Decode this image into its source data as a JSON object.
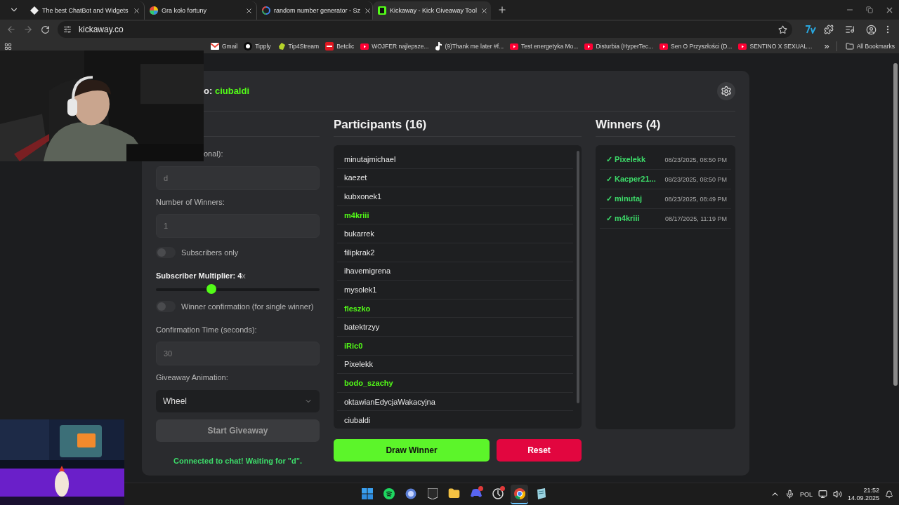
{
  "browser": {
    "tabs": [
      {
        "title": "The best ChatBot and Widgets",
        "kind": "bot",
        "selected": false
      },
      {
        "title": "Gra koło fortuny",
        "kind": "wheel",
        "selected": false
      },
      {
        "title": "random number generator - Sz",
        "kind": "google",
        "selected": false
      },
      {
        "title": "Kickaway - Kick Giveaway Tool",
        "kind": "kick",
        "selected": true
      }
    ],
    "url": "kickaway.co",
    "bookmarks": [
      {
        "label": "Gmail",
        "kind": "mail"
      },
      {
        "label": "Tipply",
        "kind": "tip"
      },
      {
        "label": "Tip4Stream",
        "kind": "hand"
      },
      {
        "label": "Betclic",
        "kind": "bet"
      },
      {
        "label": "WOJFER najlepsze...",
        "kind": "video"
      },
      {
        "label": "(9)Thank me later #f...",
        "kind": "note"
      },
      {
        "label": "Test energetyka Mo...",
        "kind": "video"
      },
      {
        "label": "Disturbia (HyperTec...",
        "kind": "video"
      },
      {
        "label": "Sen O Przyszłości (D...",
        "kind": "video"
      },
      {
        "label": "SENTINO X SEXUAL...",
        "kind": "video"
      }
    ],
    "overflow": "»",
    "all_bookmarks": "All Bookmarks"
  },
  "header": {
    "label": "o:",
    "channel": "ciubaldi"
  },
  "form": {
    "keyword_label": "onal):",
    "keyword_value": "d",
    "winners_label": "Number of Winners:",
    "winners_value": "1",
    "subscribers_only": {
      "label": "Subscribers only",
      "on": false
    },
    "multiplier": {
      "label": "Subscriber Multiplier: 4",
      "unit": "x",
      "level": 0.34
    },
    "confirmation": {
      "label": "Winner confirmation (for single winner)",
      "on": false
    },
    "time_label": "Confirmation Time (seconds):",
    "time_value": "30",
    "animation_label": "Giveaway Animation:",
    "animation_value": "Wheel",
    "start": {
      "label": "Start Giveaway",
      "disabled": true
    },
    "status": "Connected to chat! Waiting for \"d\"."
  },
  "participants": {
    "title": "Participants (16)",
    "items": [
      {
        "name": "minutajmichael",
        "highlighted": false
      },
      {
        "name": "kaezet",
        "highlighted": false
      },
      {
        "name": "kubxonek1",
        "highlighted": false
      },
      {
        "name": "m4kriii",
        "highlighted": true
      },
      {
        "name": "bukarrek",
        "highlighted": false
      },
      {
        "name": "filipkrak2",
        "highlighted": false
      },
      {
        "name": "ihavemigrena",
        "highlighted": false
      },
      {
        "name": "mysolek1",
        "highlighted": false
      },
      {
        "name": "fleszko",
        "highlighted": true
      },
      {
        "name": "batektrzyy",
        "highlighted": false
      },
      {
        "name": "iRic0",
        "highlighted": true
      },
      {
        "name": "Pixelekk",
        "highlighted": false
      },
      {
        "name": "bodo_szachy",
        "highlighted": true
      },
      {
        "name": "oktawianEdycjaWakacyjna",
        "highlighted": false
      },
      {
        "name": "ciubaldi",
        "highlighted": false
      }
    ],
    "draw_button": "Draw Winner",
    "reset_button": "Reset"
  },
  "winners": {
    "title": "Winners (4)",
    "items": [
      {
        "name": "✓ Pixelekk",
        "time": "08/23/2025, 08:50 PM"
      },
      {
        "name": "✓ Kacper21...",
        "time": "08/23/2025, 08:50 PM"
      },
      {
        "name": "✓ minutaj",
        "time": "08/23/2025, 08:49 PM"
      },
      {
        "name": "✓ m4kriii",
        "time": "08/17/2025, 11:19 PM"
      }
    ]
  },
  "taskbar": {
    "apps": [
      {
        "kind": "start",
        "active": false,
        "badge": false
      },
      {
        "kind": "music",
        "active": false,
        "badge": false
      },
      {
        "kind": "orb",
        "active": false,
        "badge": false
      },
      {
        "kind": "games",
        "active": false,
        "badge": false
      },
      {
        "kind": "folder",
        "active": false,
        "badge": false
      },
      {
        "kind": "chat",
        "active": false,
        "badge": true
      },
      {
        "kind": "dial",
        "active": false,
        "badge": true
      },
      {
        "kind": "browser",
        "active": true,
        "badge": false
      },
      {
        "kind": "notes",
        "active": false,
        "badge": false
      }
    ],
    "language": "POL",
    "time": "21:52",
    "date": "14.09.2025"
  }
}
